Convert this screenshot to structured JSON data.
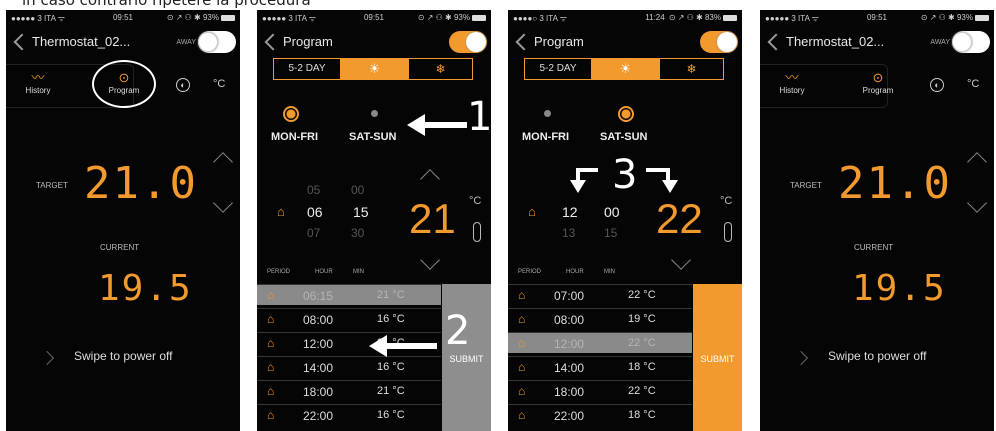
{
  "caption": "in caso contrario ripetere la procedura",
  "colors": {
    "accent": "#f29a2e",
    "background": "#050505"
  },
  "screens": [
    {
      "status": {
        "carrier": "●●●●● 3 ITA ᯤ",
        "time": "09:51",
        "right": "⊙ ↗ ⚇ ✱ 93%"
      },
      "title": "Thermostat_02...",
      "away_label": "AWAY",
      "tabs": {
        "history": "History",
        "program": "Program"
      },
      "unit": "°C",
      "target_label": "TARGET",
      "target_value": "21.0",
      "current_label": "CURRENT",
      "current_value": "19.5",
      "swipe_text": "Swipe to power off"
    },
    {
      "status": {
        "carrier": "●●●●● 3 ITA ᯤ",
        "time": "09:51",
        "right": "⊙ ↗ ⚇ ✱ 93%"
      },
      "title": "Program",
      "day_tabs": {
        "weekday": "5-2 DAY",
        "sun": "☀",
        "snow": "❄"
      },
      "days": {
        "a": "MON-FRI",
        "b": "SAT-SUN"
      },
      "picker": {
        "hour_prev": "05",
        "hour": "06",
        "hour_next": "07",
        "min_prev": "00",
        "min": "15",
        "min_next": "30"
      },
      "temp": "21",
      "unit": "°C",
      "headers": {
        "period": "PERIOD",
        "hour": "HOUR",
        "min": "MIN"
      },
      "rows": [
        {
          "time": "06:15",
          "temp": "21 °C"
        },
        {
          "time": "08:00",
          "temp": "16 °C"
        },
        {
          "time": "12:00",
          "temp": "21 °C"
        },
        {
          "time": "14:00",
          "temp": "16 °C"
        },
        {
          "time": "18:00",
          "temp": "21 °C"
        },
        {
          "time": "22:00",
          "temp": "16 °C"
        }
      ],
      "submit": "SUBMIT",
      "annotations": {
        "one": "1",
        "two": "2"
      }
    },
    {
      "status": {
        "carrier": "●●●●○ 3 ITA ᯤ",
        "time": "11:24",
        "right": "⊙ ↗ ⚇ ✱ 83%"
      },
      "title": "Program",
      "day_tabs": {
        "weekday": "5-2 DAY",
        "sun": "☀",
        "snow": "❄"
      },
      "days": {
        "a": "MON-FRI",
        "b": "SAT-SUN"
      },
      "picker": {
        "hour": "12",
        "hour_next": "13",
        "min": "00",
        "min_next": "15"
      },
      "temp": "22",
      "unit": "°C",
      "headers": {
        "period": "PERIOD",
        "hour": "HOUR",
        "min": "MIN"
      },
      "rows": [
        {
          "time": "07:00",
          "temp": "22 °C"
        },
        {
          "time": "08:00",
          "temp": "19 °C"
        },
        {
          "time": "12:00",
          "temp": "22 °C"
        },
        {
          "time": "14:00",
          "temp": "18 °C"
        },
        {
          "time": "18:00",
          "temp": "22 °C"
        },
        {
          "time": "22:00",
          "temp": "18 °C"
        }
      ],
      "submit": "SUBMIT",
      "annotations": {
        "three": "3"
      }
    },
    {
      "status": {
        "carrier": "●●●●● 3 ITA ᯤ",
        "time": "09:51",
        "right": "⊙ ↗ ⚇ ✱ 93%"
      },
      "title": "Thermostat_02...",
      "away_label": "AWAY",
      "tabs": {
        "history": "History",
        "program": "Program"
      },
      "unit": "°C",
      "target_label": "TARGET",
      "target_value": "21.0",
      "current_label": "CURRENT",
      "current_value": "19.5",
      "swipe_text": "Swipe to power off"
    }
  ]
}
